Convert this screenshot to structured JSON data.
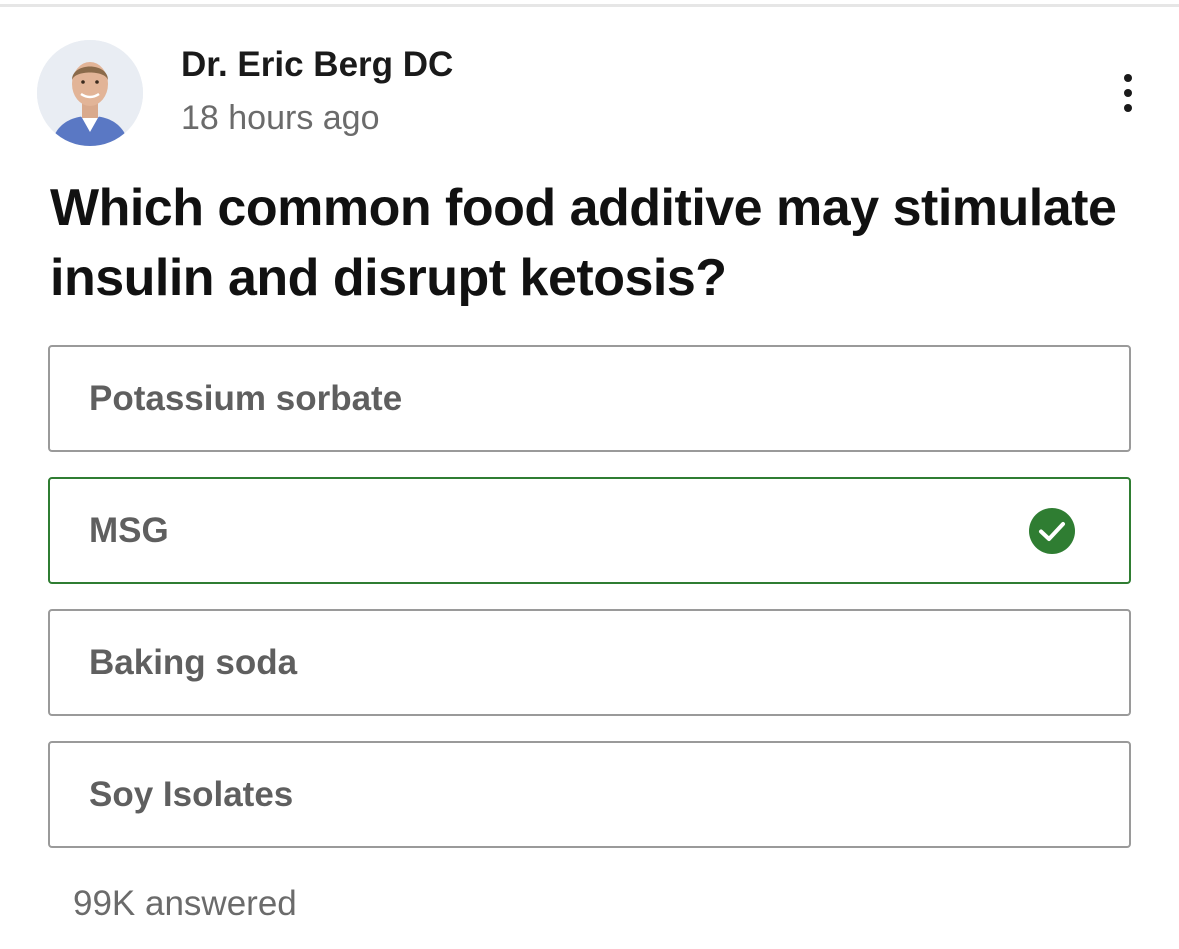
{
  "post": {
    "author": {
      "name": "Dr. Eric Berg DC",
      "avatar": "author-avatar-photo"
    },
    "time": "18 hours ago",
    "more_icon": "more-vertical-icon"
  },
  "quiz": {
    "question": "Which common food additive may stimulate insulin and disrupt ketosis?",
    "options": [
      {
        "label": "Potassium sorbate",
        "state": "neutral"
      },
      {
        "label": "MSG",
        "state": "correct"
      },
      {
        "label": "Baking soda",
        "state": "neutral"
      },
      {
        "label": "Soy Isolates",
        "state": "neutral"
      }
    ],
    "correct_icon": "check-circle-icon",
    "answered": "99K answered"
  },
  "colors": {
    "correct_accent": "#2f7d32",
    "neutral_border": "#9a9a9a",
    "option_text": "#5f5f5f",
    "secondary_text": "#6b6b6b"
  }
}
